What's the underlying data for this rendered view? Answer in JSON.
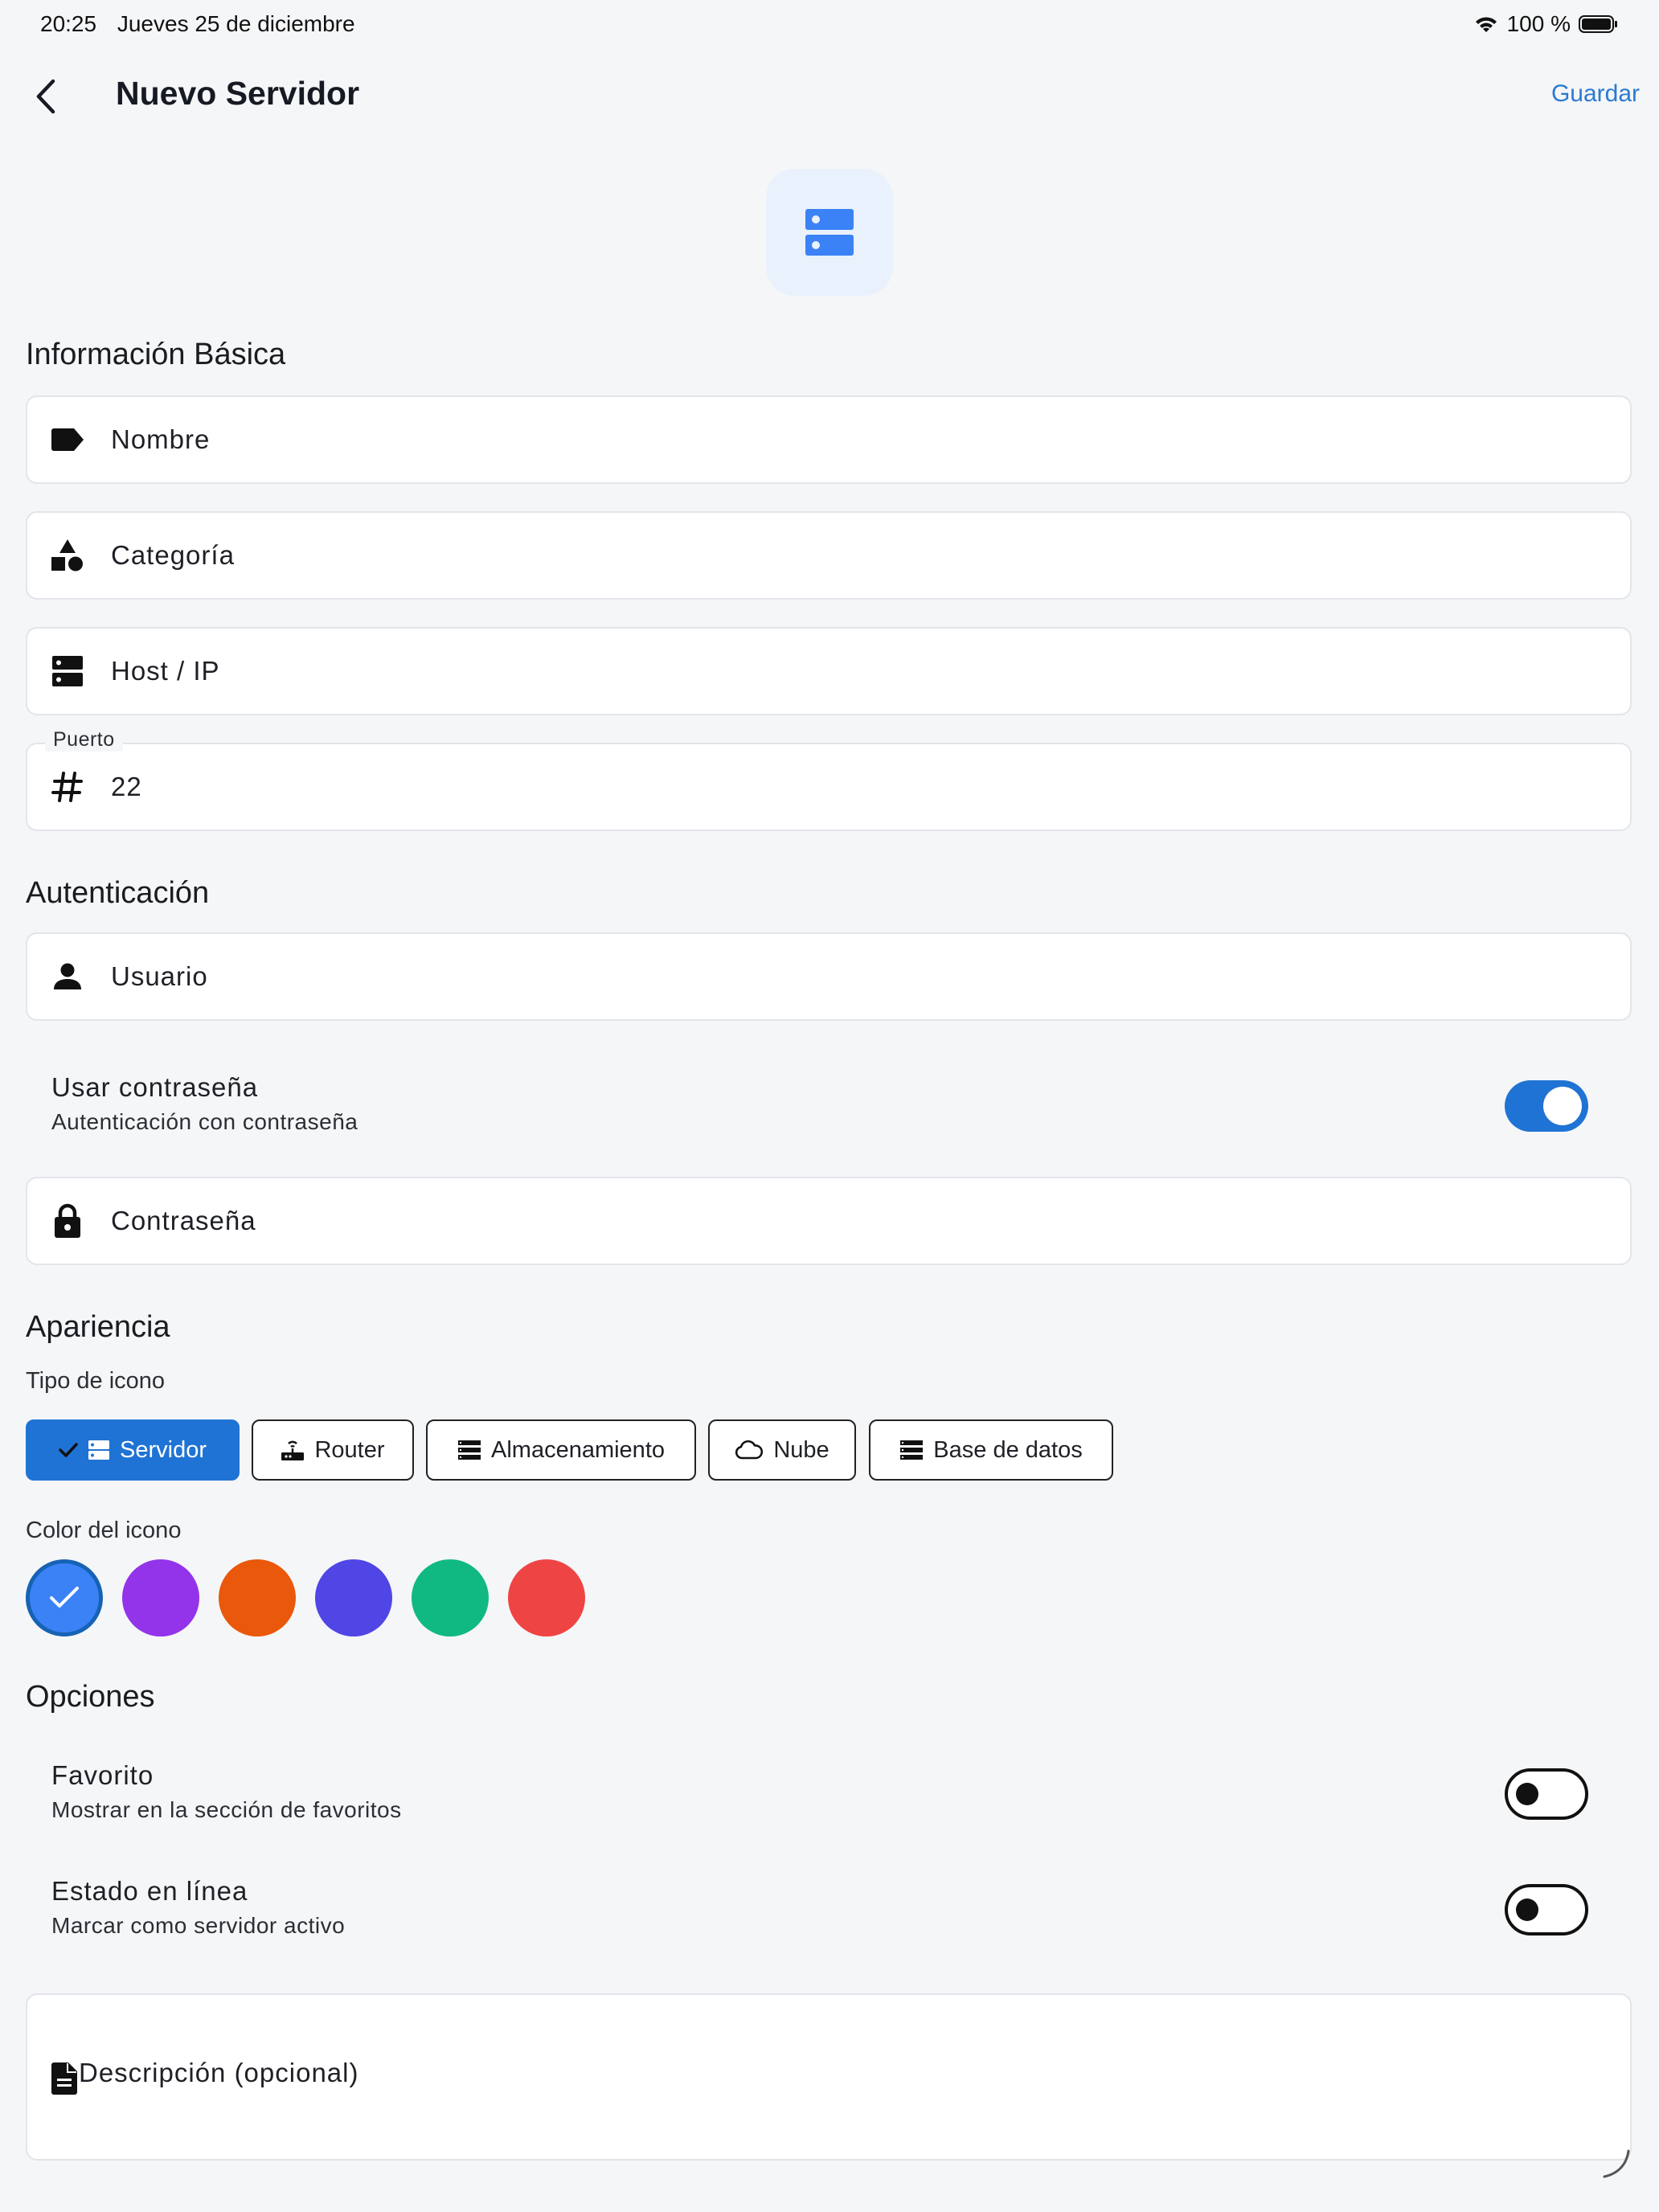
{
  "status_bar": {
    "time": "20:25",
    "date": "Jueves 25 de diciembre",
    "battery": "100 %"
  },
  "header": {
    "title": "Nuevo Servidor",
    "save_label": "Guardar"
  },
  "basic_info": {
    "title": "Información Básica",
    "name_placeholder": "Nombre",
    "category_placeholder": "Categoría",
    "host_placeholder": "Host / IP",
    "port_label": "Puerto",
    "port_value": "22"
  },
  "auth": {
    "title": "Autenticación",
    "user_placeholder": "Usuario",
    "use_password": {
      "title": "Usar contraseña",
      "subtitle": "Autenticación con contraseña",
      "enabled": true
    },
    "password_placeholder": "Contraseña"
  },
  "appearance": {
    "title": "Apariencia",
    "icon_type_label": "Tipo de icono",
    "icon_types": [
      {
        "label": "Servidor",
        "icon": "server-icon",
        "selected": true
      },
      {
        "label": "Router",
        "icon": "router-icon",
        "selected": false
      },
      {
        "label": "Almacenamiento",
        "icon": "storage-icon",
        "selected": false
      },
      {
        "label": "Nube",
        "icon": "cloud-icon",
        "selected": false
      },
      {
        "label": "Base de datos",
        "icon": "database-icon",
        "selected": false
      }
    ],
    "icon_color_label": "Color del icono",
    "colors": [
      "#3b82f6",
      "#9333ea",
      "#ea580c",
      "#4f46e5",
      "#10b981",
      "#ef4444"
    ],
    "selected_color_index": 0
  },
  "options": {
    "title": "Opciones",
    "favorite": {
      "title": "Favorito",
      "subtitle": "Mostrar en la sección de favoritos",
      "enabled": false
    },
    "online": {
      "title": "Estado en línea",
      "subtitle": "Marcar como servidor activo",
      "enabled": false
    },
    "description_placeholder": "Descripción (opcional)"
  }
}
